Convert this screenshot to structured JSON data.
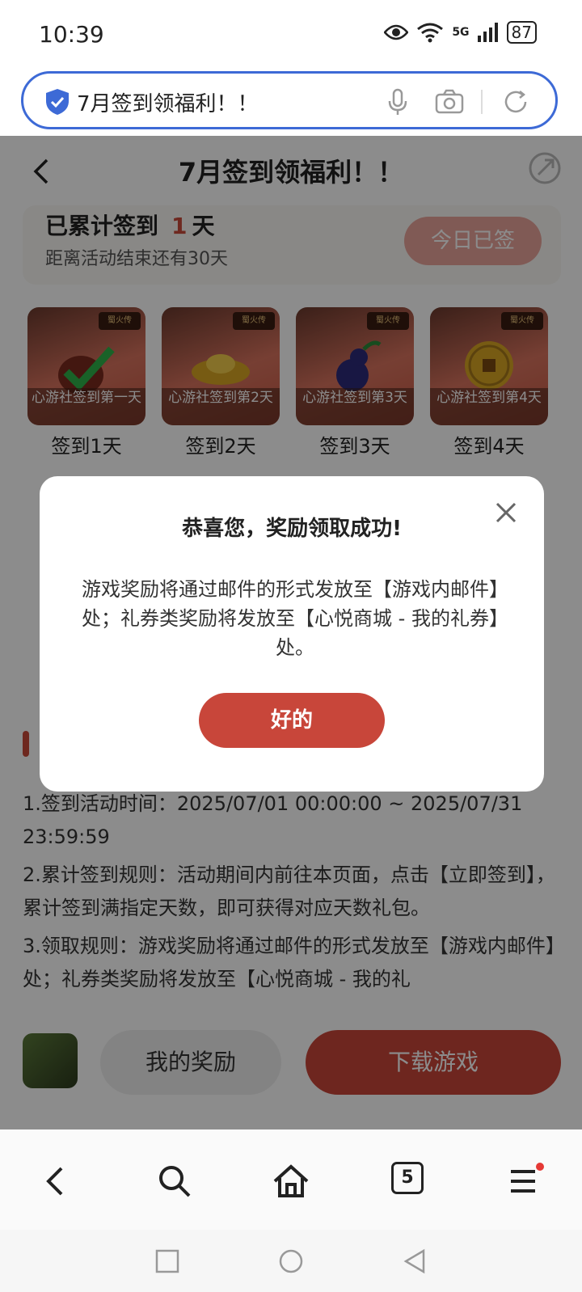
{
  "status_bar": {
    "time": "10:39",
    "network": "5G",
    "battery": "87"
  },
  "address_bar": {
    "text": "7月签到领福利！！"
  },
  "page": {
    "title": "7月签到领福利！！",
    "summary": {
      "prefix": "已累计签到",
      "count": "1",
      "suffix": "天",
      "subtitle": "距离活动结束还有30天",
      "button": "今日已签"
    },
    "rewards": [
      {
        "caption": "心游社签到第一天",
        "day": "签到1天",
        "icon": "bag-with-check-icon"
      },
      {
        "caption": "心游社签到第2天",
        "day": "签到2天",
        "icon": "gold-ingot-icon"
      },
      {
        "caption": "心游社签到第3天",
        "day": "签到3天",
        "icon": "purple-gourd-icon"
      },
      {
        "caption": "心游社签到第4天",
        "day": "签到4天",
        "icon": "gold-coin-icon"
      }
    ],
    "rules": [
      "1.签到活动时间：2025/07/01 00:00:00 ~ 2025/07/31 23:59:59",
      "2.累计签到规则：活动期间内前往本页面，点击【立即签到】，累计签到满指定天数，即可获得对应天数礼包。",
      "3.领取规则：游戏奖励将通过邮件的形式发放至【游戏内邮件】处；礼券类奖励将发放至【心悦商城 - 我的礼"
    ],
    "my_reward_button": "我的奖励",
    "download_button": "下载游戏"
  },
  "dialog": {
    "title": "恭喜您，奖励领取成功!",
    "body": "游戏奖励将通过邮件的形式发放至【游戏内邮件】处；礼券类奖励将发放至【心悦商城 - 我的礼券】处。",
    "ok_button": "好的"
  },
  "browser_nav": {
    "tab_count": "5"
  },
  "colors": {
    "accent": "#c8463a",
    "address_border": "#3d6ad6"
  }
}
